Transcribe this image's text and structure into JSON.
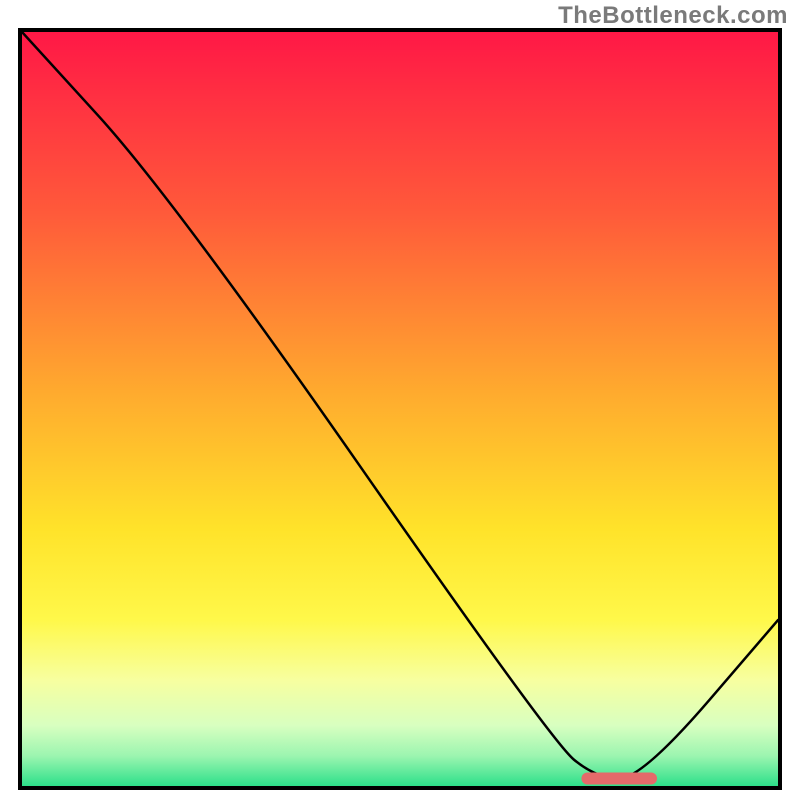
{
  "watermark": "TheBottleneck.com",
  "colors": {
    "frame": "#000000",
    "curve": "#000000",
    "marker_fill": "#e46a6a",
    "gradient_stops": [
      {
        "offset": 0.0,
        "color": "#ff1846"
      },
      {
        "offset": 0.24,
        "color": "#ff5a3a"
      },
      {
        "offset": 0.48,
        "color": "#ffab2e"
      },
      {
        "offset": 0.66,
        "color": "#ffe32a"
      },
      {
        "offset": 0.78,
        "color": "#fff84a"
      },
      {
        "offset": 0.86,
        "color": "#f7ffa0"
      },
      {
        "offset": 0.92,
        "color": "#d8ffc0"
      },
      {
        "offset": 0.96,
        "color": "#9cf5b0"
      },
      {
        "offset": 1.0,
        "color": "#2de08a"
      }
    ]
  },
  "chart_data": {
    "type": "line",
    "title": "",
    "xlabel": "",
    "ylabel": "",
    "xlim": [
      0,
      100
    ],
    "ylim": [
      0,
      100
    ],
    "x": [
      0,
      20,
      70,
      76,
      82,
      100
    ],
    "values": [
      100,
      78,
      6,
      1,
      1,
      22
    ],
    "marker": {
      "x_start": 74,
      "x_end": 84,
      "y": 1
    }
  }
}
